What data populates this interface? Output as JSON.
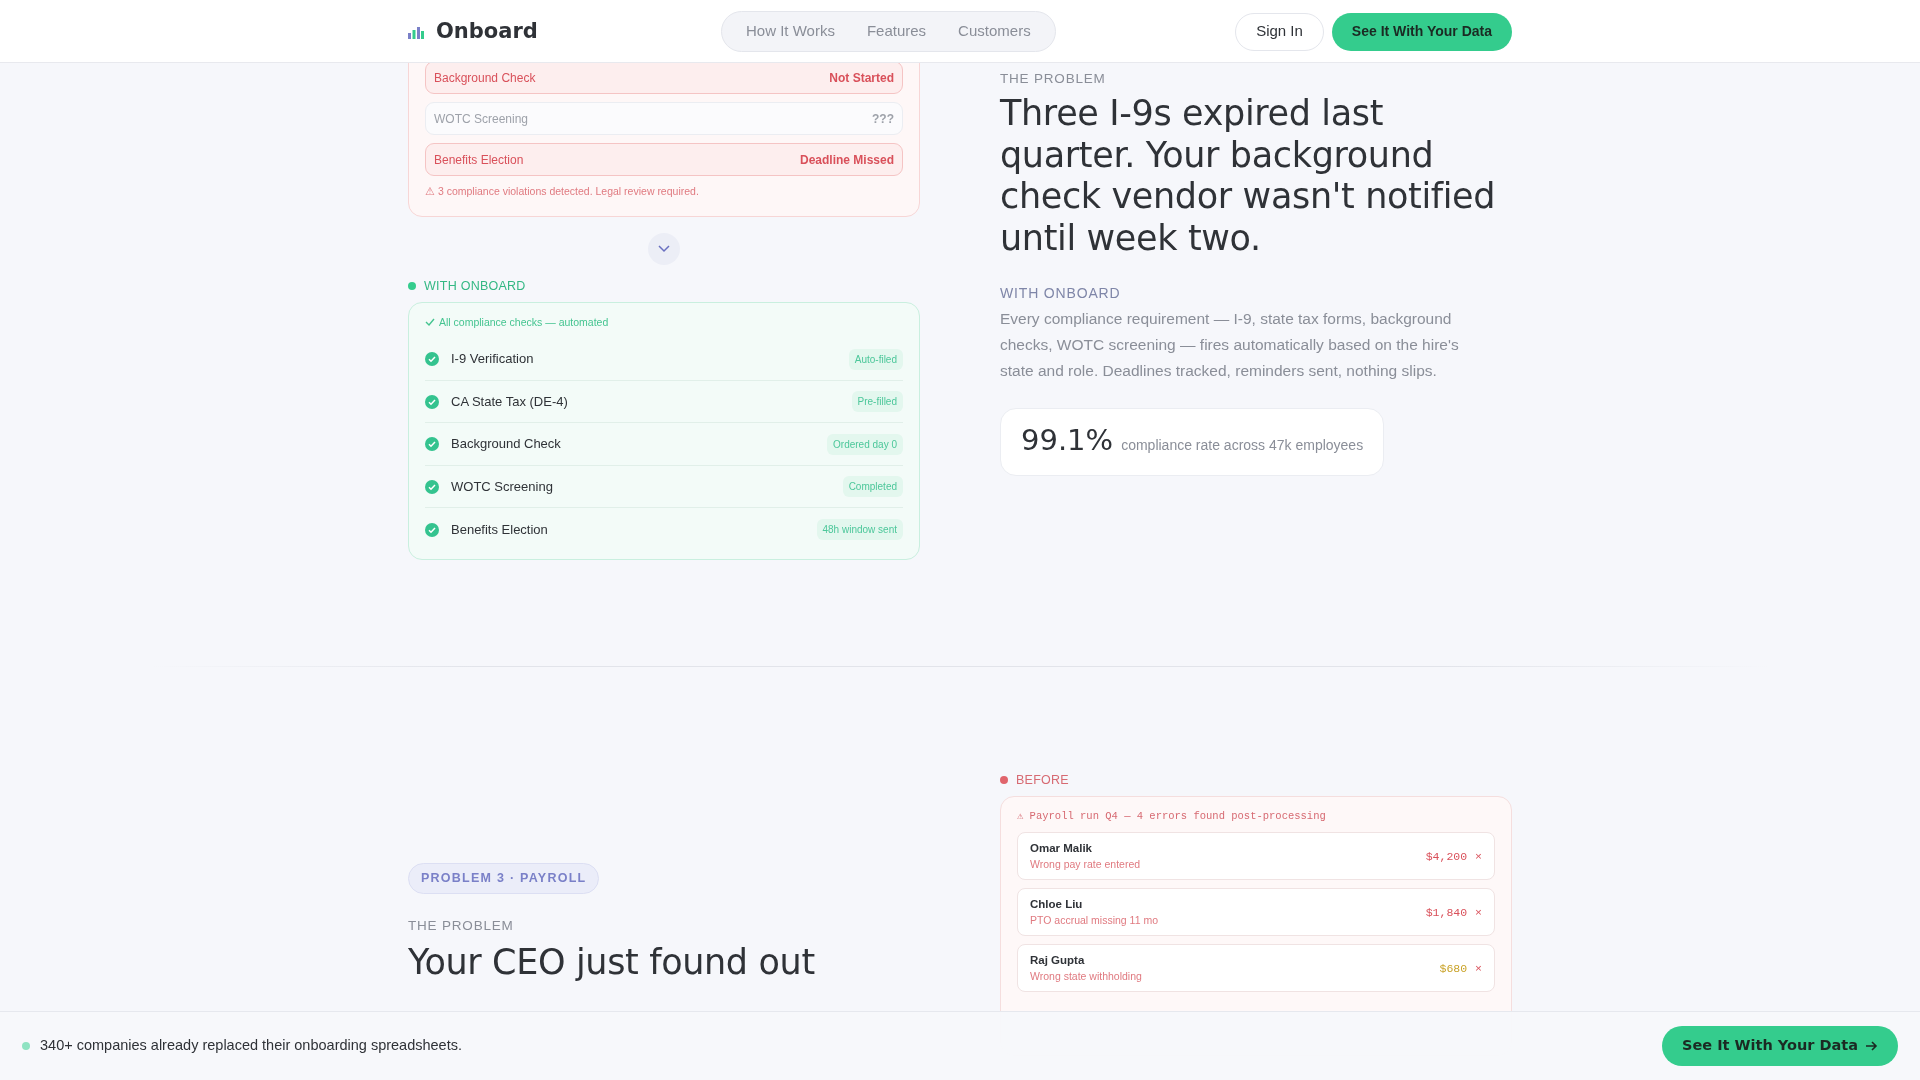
{
  "header": {
    "logo": "Onboard",
    "nav": [
      {
        "label": "How It Works"
      },
      {
        "label": "Features"
      },
      {
        "label": "Customers"
      }
    ],
    "sign_in": "Sign In",
    "cta": "See It With Your Data"
  },
  "before_checklist": {
    "rows": [
      {
        "label": "Background Check",
        "status": "Not Started",
        "kind": "error"
      },
      {
        "label": "WOTC Screening",
        "status": "???",
        "kind": "unknown"
      },
      {
        "label": "Benefits Election",
        "status": "Deadline Missed",
        "kind": "error"
      }
    ],
    "note": "⚠ 3 compliance violations detected. Legal review required."
  },
  "after_checklist": {
    "label": "WITH ONBOARD",
    "header": "All compliance checks — automated",
    "rows": [
      {
        "label": "I-9 Verification",
        "status": "Auto-filed"
      },
      {
        "label": "CA State Tax (DE-4)",
        "status": "Pre-filled"
      },
      {
        "label": "Background Check",
        "status": "Ordered day 0"
      },
      {
        "label": "WOTC Screening",
        "status": "Completed"
      },
      {
        "label": "Benefits Election",
        "status": "48h window sent"
      }
    ]
  },
  "problem_2": {
    "eyebrow": "THE PROBLEM",
    "heading": "Three I-9s expired last quarter. Your background check vendor wasn't notified until week two.",
    "solution_label": "WITH ONBOARD",
    "solution_text": "Every compliance requirement — I-9, state tax forms, background checks, WOTC screening — fires automatically based on the hire's state and role. Deadlines tracked, reminders sent, nothing slips.",
    "stat": {
      "value": "99.1%",
      "caption": "compliance rate across 47k employees"
    }
  },
  "problem_3": {
    "tag": "PROBLEM 3 · PAYROLL",
    "eyebrow": "THE PROBLEM",
    "heading": "Your CEO just found out"
  },
  "payroll_before": {
    "label": "BEFORE",
    "header": "⚠ Payroll run Q4 — 4 errors found post-processing",
    "rows": [
      {
        "name": "Omar Malik",
        "issue": "Wrong pay rate entered",
        "amount": "$4,200",
        "close": "×",
        "color": "#d9505a"
      },
      {
        "name": "Chloe Liu",
        "issue": "PTO accrual missing 11 mo",
        "amount": "$1,840",
        "close": "×",
        "color": "#d9505a"
      },
      {
        "name": "Raj Gupta",
        "issue": "Wrong state withholding",
        "amount": "$680",
        "close": "×",
        "color": "#c9a227"
      }
    ]
  },
  "bottom_bar": {
    "text": "340+ companies already replaced their onboarding spreadsheets.",
    "cta": "See It With Your Data"
  }
}
